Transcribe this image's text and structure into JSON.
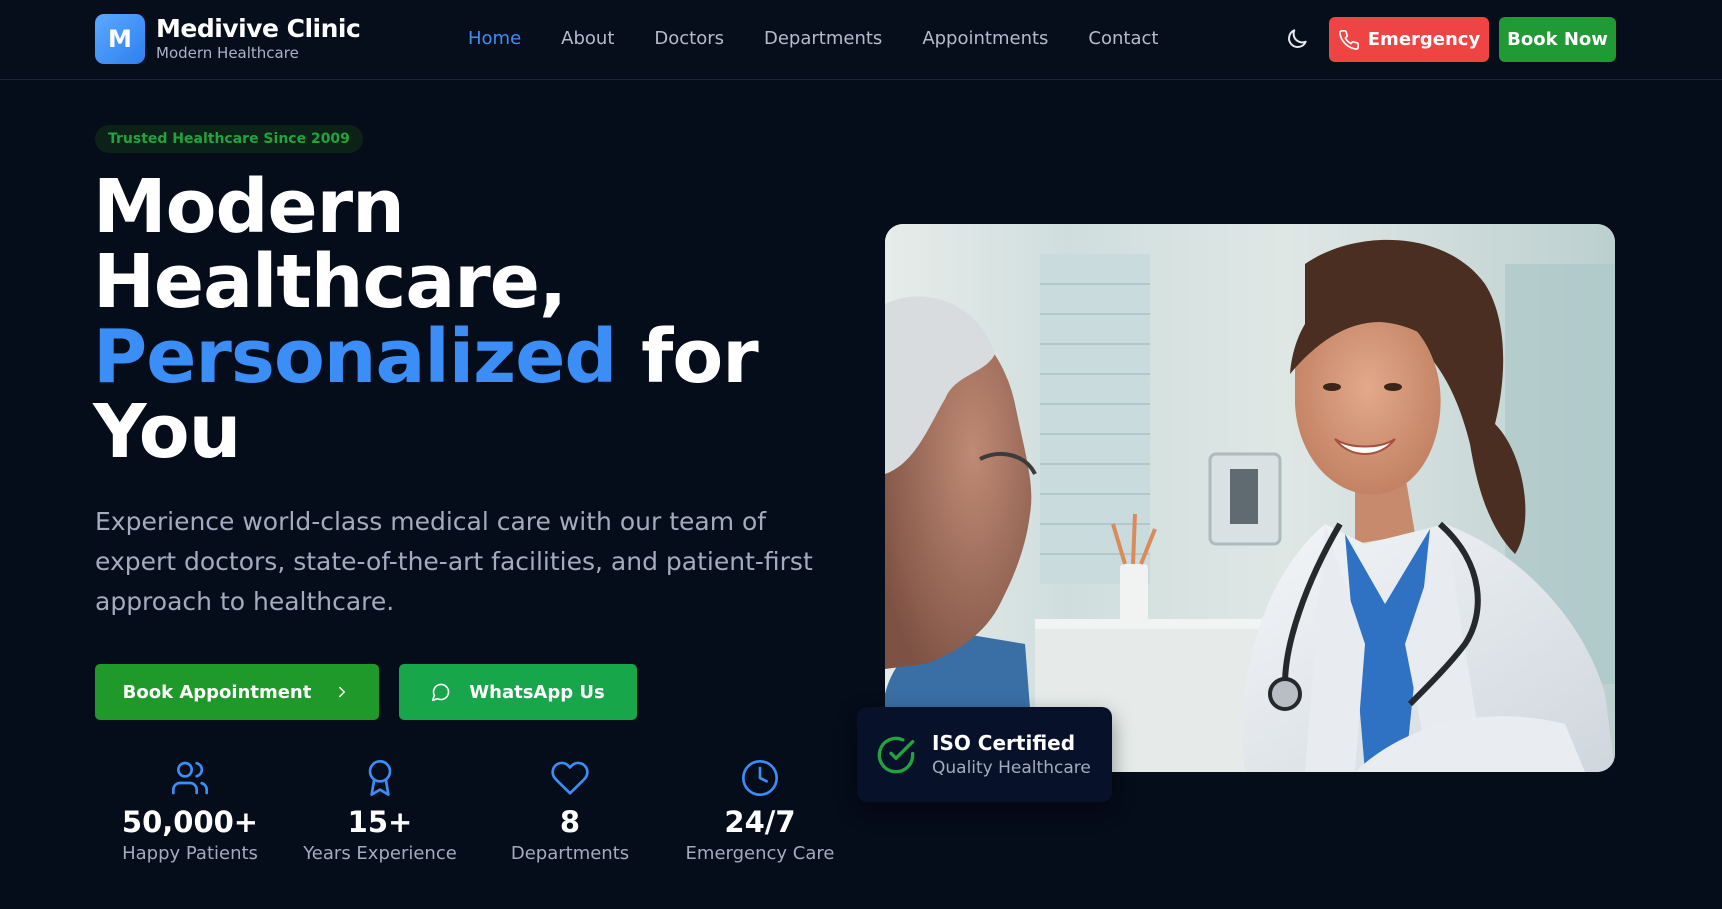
{
  "brand": {
    "initial": "M",
    "name": "Medivive Clinic",
    "tagline": "Modern Healthcare",
    "accent": "#3a8ef6"
  },
  "nav": {
    "links": [
      {
        "label": "Home",
        "active": true
      },
      {
        "label": "About",
        "active": false
      },
      {
        "label": "Doctors",
        "active": false
      },
      {
        "label": "Departments",
        "active": false
      },
      {
        "label": "Appointments",
        "active": false
      },
      {
        "label": "Contact",
        "active": false
      }
    ],
    "theme_toggle_icon": "moon-icon",
    "emergency_label": "Emergency",
    "emergency_color": "#ef4444",
    "book_now_label": "Book Now",
    "book_now_color": "#1f9a34"
  },
  "hero": {
    "badge": "Trusted Healthcare Since 2009",
    "headline_line1": "Modern",
    "headline_line2": "Healthcare,",
    "headline_highlight": "Personalized",
    "headline_after": "for",
    "headline_line4": "You",
    "lead": "Experience world-class medical care with our team of expert doctors, state-of-the-art facilities, and patient-first approach to healthcare.",
    "primary_cta": "Book Appointment",
    "secondary_cta": "WhatsApp Us"
  },
  "stats": [
    {
      "icon": "users-icon",
      "value": "50,000+",
      "label": "Happy Patients"
    },
    {
      "icon": "award-icon",
      "value": "15+",
      "label": "Years Experience"
    },
    {
      "icon": "heart-icon",
      "value": "8",
      "label": "Departments"
    },
    {
      "icon": "clock-icon",
      "value": "24/7",
      "label": "Emergency Care"
    }
  ],
  "iso_card": {
    "icon": "check-circle-icon",
    "title": "ISO Certified",
    "subtitle": "Quality Healthcare"
  }
}
